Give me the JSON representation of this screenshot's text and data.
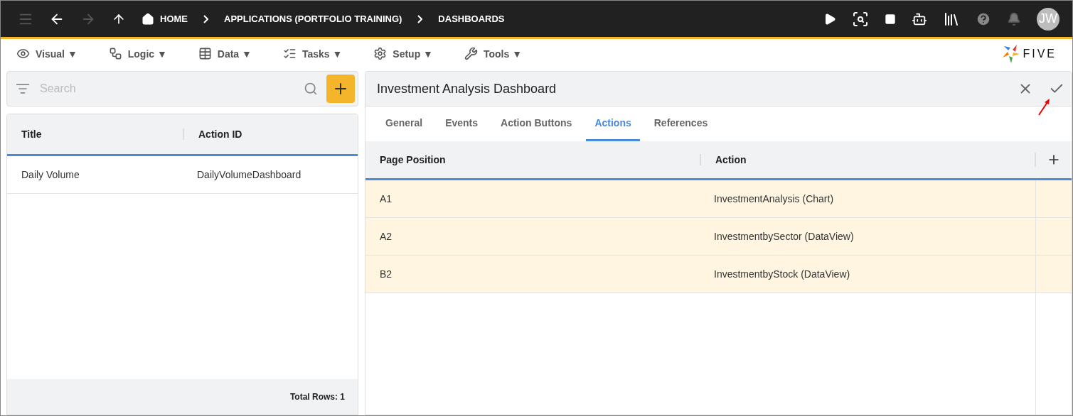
{
  "topbar": {
    "forward_disabled": true,
    "breadcrumbs": [
      "HOME",
      "APPLICATIONS (PORTFOLIO TRAINING)",
      "DASHBOARDS"
    ],
    "avatar": "JW"
  },
  "menu": [
    {
      "kind": "visual",
      "label": "Visual ▼"
    },
    {
      "kind": "logic",
      "label": "Logic ▼"
    },
    {
      "kind": "data",
      "label": "Data ▼"
    },
    {
      "kind": "tasks",
      "label": "Tasks ▼"
    },
    {
      "kind": "setup",
      "label": "Setup ▼"
    },
    {
      "kind": "tools",
      "label": "Tools ▼"
    }
  ],
  "logo": "FIVE",
  "list": {
    "search": {
      "placeholder": "Search"
    },
    "columns": [
      "Title",
      "Action ID"
    ],
    "rows": [
      [
        "Daily Volume",
        "DailyVolumeDashboard"
      ]
    ],
    "total": "Total Rows: 1"
  },
  "form": {
    "title": "Investment Analysis Dashboard",
    "tabs": [
      {
        "label": "General",
        "selected": false
      },
      {
        "label": "Events",
        "selected": false
      },
      {
        "label": "Action Buttons",
        "selected": false
      },
      {
        "label": "Actions",
        "selected": true
      },
      {
        "label": "References",
        "selected": false
      }
    ],
    "columns": [
      "Page Position",
      "Action"
    ],
    "rows": [
      [
        "A1",
        "InvestmentAnalysis (Chart)"
      ],
      [
        "A2",
        "InvestmentbySector (DataView)"
      ],
      [
        "B2",
        "InvestmentbyStock (DataView)"
      ]
    ]
  }
}
